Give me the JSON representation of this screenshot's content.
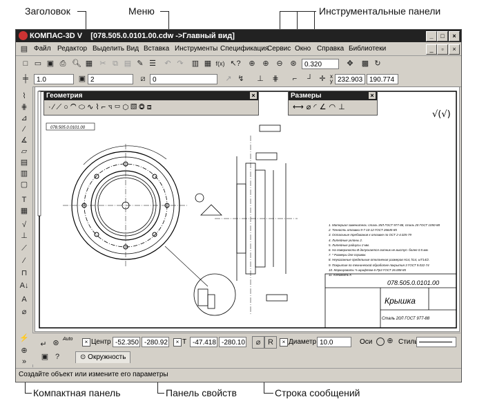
{
  "callouts": {
    "title": "Заголовок",
    "menu": "Меню",
    "toolbars": "Инструментальные панели",
    "compact": "Компактная панель",
    "properties": "Панель свойств",
    "messages": "Строка сообщений"
  },
  "window": {
    "title": "КОМПАС-3D V    [078.505.0.0101.00.cdw ->Главный вид]",
    "buttons": [
      "_",
      "□",
      "×"
    ]
  },
  "menu": {
    "items": [
      "Файл",
      "Редактор",
      "Выделить",
      "Вид",
      "Вставка",
      "Инструменты",
      "Спецификация",
      "Сервис",
      "Окно",
      "Справка",
      "Библиотеки"
    ]
  },
  "toolbar1": {
    "zoom_value": "0.320"
  },
  "toolbar2": {
    "line_width": "1.0",
    "layer_value": "2",
    "style_value": "0",
    "coord_x": "232.903",
    "coord_y": "190.774",
    "coord_x_label": "x",
    "coord_y_label": "y"
  },
  "panels": {
    "geometry": "Геометрия",
    "dimensions": "Размеры"
  },
  "drawing": {
    "stamp_code": "078.505.0.0101.00",
    "part_name": "Крышка",
    "material": "Сталь 20Л ГОСТ 977-88",
    "corner_code": "078.505.0.0101.00",
    "roughness": "√(√)",
    "notes": [
      "1. Материал заменитель: сталь 35Л ГОСТ 977-88, сталь 20 ГОСТ 1050-88",
      "2. Точность отливки 9-7-10-12 ГОСТ 26645-85",
      "3. Остальные требования к отливке по ОСТ 2-4.025-79",
      "4. Литейные уклоны 2.",
      "5. Литейные радиусы 2 мм.",
      "6. На поверхности В допускается литник не выступ. более 0.5 мм.",
      "7. * Размеры для справок.",
      "8. Неуказанные предельные отклонения размеров H14, h14, ±IT14/2.",
      "9. Покрытие по технической обработке покрытия 3 ГОСТ 9.032-74",
      "10. Маркировать Ч шрифтом 6-Пр3 ГОСТ 26.008-85",
      "11. Клеймить К"
    ]
  },
  "properties": {
    "center_label": "Центр",
    "center_x": "-52.350",
    "center_y": "-280.92",
    "point_label": "Т",
    "point_x": "-47.418",
    "point_y": "-280.10",
    "r_button": "R",
    "diameter_label": "Диаметр",
    "diameter_value": "10.0",
    "axes_label": "Оси",
    "style_label": "Стиль",
    "tab_label": "Окружность",
    "auto_label": "Auto"
  },
  "status": {
    "message": "Создайте объект или измените его параметры"
  }
}
